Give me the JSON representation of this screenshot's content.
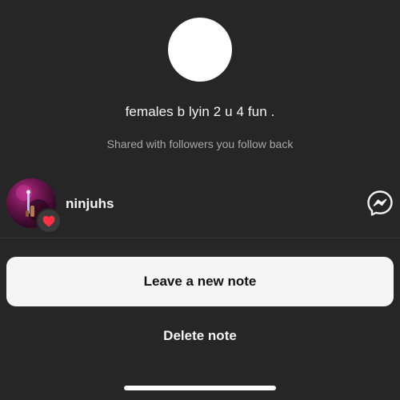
{
  "note": {
    "text": "females b lyin 2 u 4 fun .",
    "audience": "Shared with followers you follow back"
  },
  "liker": {
    "username": "ninjuhs",
    "reaction_icon": "heart-icon",
    "reaction_color": "#ff3040",
    "action_icon": "messenger-icon"
  },
  "actions": {
    "leave_new_note": "Leave a new note",
    "delete_note": "Delete note"
  },
  "colors": {
    "background": "#262626",
    "primary_button": "#f5f5f5",
    "secondary_text": "#a8a8a8"
  }
}
